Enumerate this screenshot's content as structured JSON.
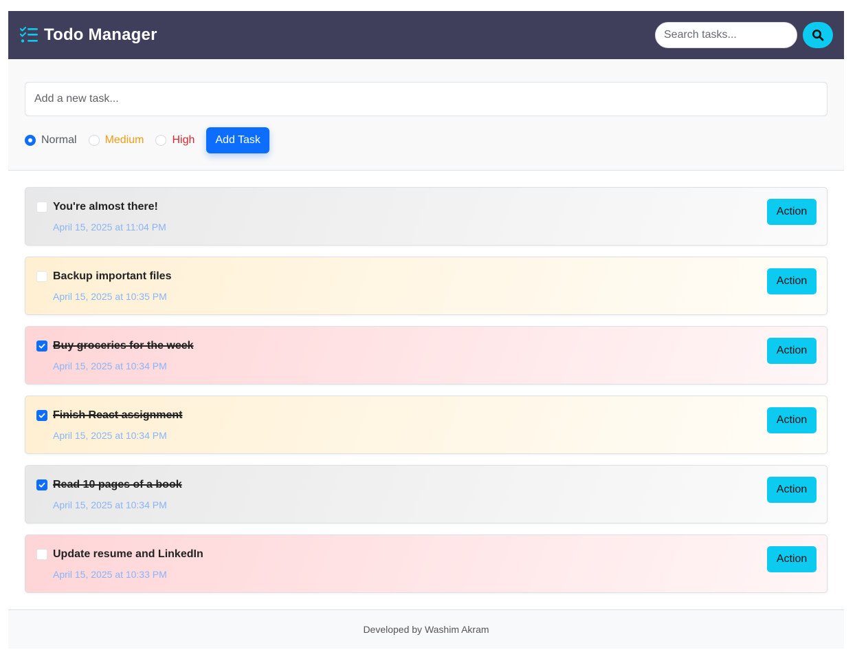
{
  "header": {
    "title": "Todo Manager",
    "brand_icon": "list-check-icon",
    "search_placeholder": "Search tasks...",
    "search_icon": "search-icon"
  },
  "colors": {
    "header_bg": "#3f3f5b",
    "accent_cyan": "#0dcaf0",
    "primary_blue": "#0d6efd",
    "medium": "#f39c12",
    "high": "#d9262e",
    "date": "#8ab4f8"
  },
  "add_form": {
    "placeholder": "Add a new task...",
    "priorities": [
      {
        "label": "Normal",
        "selected": true
      },
      {
        "label": "Medium",
        "selected": false
      },
      {
        "label": "High",
        "selected": false
      }
    ],
    "add_label": "Add Task"
  },
  "tasks": [
    {
      "title": "You're almost there!",
      "date": "April 15, 2025 at 11:04 PM",
      "priority": "normal",
      "done": false,
      "action_label": "Action"
    },
    {
      "title": "Backup important files",
      "date": "April 15, 2025 at 10:35 PM",
      "priority": "medium",
      "done": false,
      "action_label": "Action"
    },
    {
      "title": "Buy groceries for the week",
      "date": "April 15, 2025 at 10:34 PM",
      "priority": "high",
      "done": true,
      "action_label": "Action"
    },
    {
      "title": "Finish React assignment",
      "date": "April 15, 2025 at 10:34 PM",
      "priority": "medium",
      "done": true,
      "action_label": "Action"
    },
    {
      "title": "Read 10 pages of a book",
      "date": "April 15, 2025 at 10:34 PM",
      "priority": "normal",
      "done": true,
      "action_label": "Action"
    },
    {
      "title": "Update resume and LinkedIn",
      "date": "April 15, 2025 at 10:33 PM",
      "priority": "high",
      "done": false,
      "action_label": "Action"
    }
  ],
  "footer": {
    "text": "Developed by Washim Akram"
  }
}
